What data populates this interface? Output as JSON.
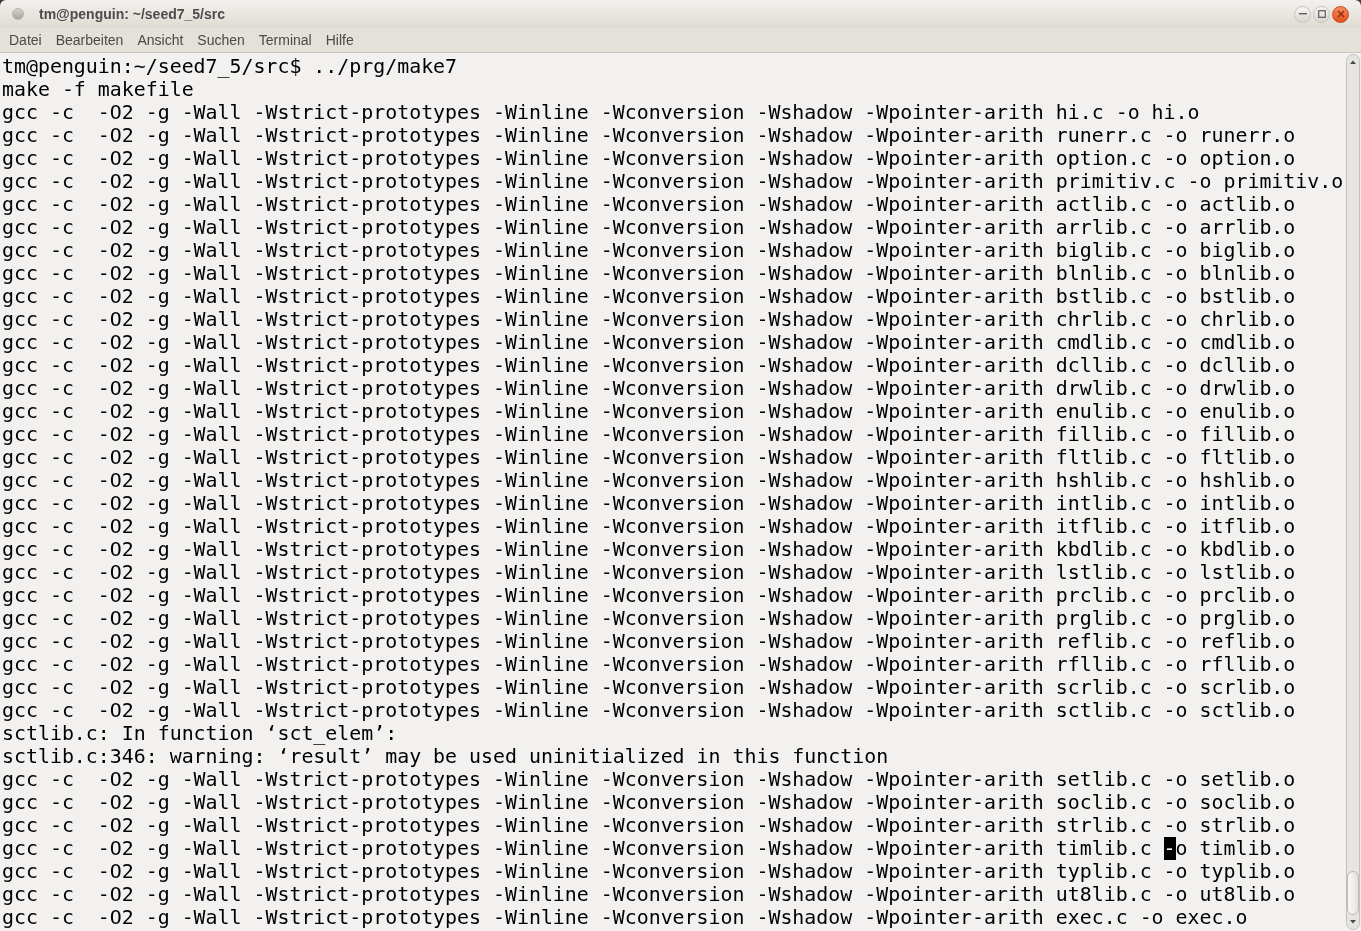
{
  "window": {
    "title": "tm@penguin: ~/seed7_5/src"
  },
  "menu": [
    "Datei",
    "Bearbeiten",
    "Ansicht",
    "Suchen",
    "Terminal",
    "Hilfe"
  ],
  "terminal": {
    "lines": [
      {
        "kind": "plain",
        "text": "tm@penguin:~/seed7_5/src$ ../prg/make7"
      },
      {
        "kind": "plain",
        "text": "make -f makefile"
      },
      {
        "kind": "plain",
        "text": "gcc -c  -O2 -g -Wall -Wstrict-prototypes -Winline -Wconversion -Wshadow -Wpointer-arith hi.c -o hi.o"
      },
      {
        "kind": "plain",
        "text": "gcc -c  -O2 -g -Wall -Wstrict-prototypes -Winline -Wconversion -Wshadow -Wpointer-arith runerr.c -o runerr.o"
      },
      {
        "kind": "plain",
        "text": "gcc -c  -O2 -g -Wall -Wstrict-prototypes -Winline -Wconversion -Wshadow -Wpointer-arith option.c -o option.o"
      },
      {
        "kind": "plain",
        "text": "gcc -c  -O2 -g -Wall -Wstrict-prototypes -Winline -Wconversion -Wshadow -Wpointer-arith primitiv.c -o primitiv.o"
      },
      {
        "kind": "plain",
        "text": "gcc -c  -O2 -g -Wall -Wstrict-prototypes -Winline -Wconversion -Wshadow -Wpointer-arith actlib.c -o actlib.o"
      },
      {
        "kind": "plain",
        "text": "gcc -c  -O2 -g -Wall -Wstrict-prototypes -Winline -Wconversion -Wshadow -Wpointer-arith arrlib.c -o arrlib.o"
      },
      {
        "kind": "plain",
        "text": "gcc -c  -O2 -g -Wall -Wstrict-prototypes -Winline -Wconversion -Wshadow -Wpointer-arith biglib.c -o biglib.o"
      },
      {
        "kind": "plain",
        "text": "gcc -c  -O2 -g -Wall -Wstrict-prototypes -Winline -Wconversion -Wshadow -Wpointer-arith blnlib.c -o blnlib.o"
      },
      {
        "kind": "plain",
        "text": "gcc -c  -O2 -g -Wall -Wstrict-prototypes -Winline -Wconversion -Wshadow -Wpointer-arith bstlib.c -o bstlib.o"
      },
      {
        "kind": "plain",
        "text": "gcc -c  -O2 -g -Wall -Wstrict-prototypes -Winline -Wconversion -Wshadow -Wpointer-arith chrlib.c -o chrlib.o"
      },
      {
        "kind": "plain",
        "text": "gcc -c  -O2 -g -Wall -Wstrict-prototypes -Winline -Wconversion -Wshadow -Wpointer-arith cmdlib.c -o cmdlib.o"
      },
      {
        "kind": "plain",
        "text": "gcc -c  -O2 -g -Wall -Wstrict-prototypes -Winline -Wconversion -Wshadow -Wpointer-arith dcllib.c -o dcllib.o"
      },
      {
        "kind": "plain",
        "text": "gcc -c  -O2 -g -Wall -Wstrict-prototypes -Winline -Wconversion -Wshadow -Wpointer-arith drwlib.c -o drwlib.o"
      },
      {
        "kind": "plain",
        "text": "gcc -c  -O2 -g -Wall -Wstrict-prototypes -Winline -Wconversion -Wshadow -Wpointer-arith enulib.c -o enulib.o"
      },
      {
        "kind": "plain",
        "text": "gcc -c  -O2 -g -Wall -Wstrict-prototypes -Winline -Wconversion -Wshadow -Wpointer-arith fillib.c -o fillib.o"
      },
      {
        "kind": "plain",
        "text": "gcc -c  -O2 -g -Wall -Wstrict-prototypes -Winline -Wconversion -Wshadow -Wpointer-arith fltlib.c -o fltlib.o"
      },
      {
        "kind": "plain",
        "text": "gcc -c  -O2 -g -Wall -Wstrict-prototypes -Winline -Wconversion -Wshadow -Wpointer-arith hshlib.c -o hshlib.o"
      },
      {
        "kind": "plain",
        "text": "gcc -c  -O2 -g -Wall -Wstrict-prototypes -Winline -Wconversion -Wshadow -Wpointer-arith intlib.c -o intlib.o"
      },
      {
        "kind": "plain",
        "text": "gcc -c  -O2 -g -Wall -Wstrict-prototypes -Winline -Wconversion -Wshadow -Wpointer-arith itflib.c -o itflib.o"
      },
      {
        "kind": "plain",
        "text": "gcc -c  -O2 -g -Wall -Wstrict-prototypes -Winline -Wconversion -Wshadow -Wpointer-arith kbdlib.c -o kbdlib.o"
      },
      {
        "kind": "plain",
        "text": "gcc -c  -O2 -g -Wall -Wstrict-prototypes -Winline -Wconversion -Wshadow -Wpointer-arith lstlib.c -o lstlib.o"
      },
      {
        "kind": "plain",
        "text": "gcc -c  -O2 -g -Wall -Wstrict-prototypes -Winline -Wconversion -Wshadow -Wpointer-arith prclib.c -o prclib.o"
      },
      {
        "kind": "plain",
        "text": "gcc -c  -O2 -g -Wall -Wstrict-prototypes -Winline -Wconversion -Wshadow -Wpointer-arith prglib.c -o prglib.o"
      },
      {
        "kind": "plain",
        "text": "gcc -c  -O2 -g -Wall -Wstrict-prototypes -Winline -Wconversion -Wshadow -Wpointer-arith reflib.c -o reflib.o"
      },
      {
        "kind": "plain",
        "text": "gcc -c  -O2 -g -Wall -Wstrict-prototypes -Winline -Wconversion -Wshadow -Wpointer-arith rfllib.c -o rfllib.o"
      },
      {
        "kind": "plain",
        "text": "gcc -c  -O2 -g -Wall -Wstrict-prototypes -Winline -Wconversion -Wshadow -Wpointer-arith scrlib.c -o scrlib.o"
      },
      {
        "kind": "plain",
        "text": "gcc -c  -O2 -g -Wall -Wstrict-prototypes -Winline -Wconversion -Wshadow -Wpointer-arith sctlib.c -o sctlib.o"
      },
      {
        "kind": "plain",
        "text": "sctlib.c: In function ‘sct_elem’:"
      },
      {
        "kind": "plain",
        "text": "sctlib.c:346: warning: ‘result’ may be used uninitialized in this function"
      },
      {
        "kind": "plain",
        "text": "gcc -c  -O2 -g -Wall -Wstrict-prototypes -Winline -Wconversion -Wshadow -Wpointer-arith setlib.c -o setlib.o"
      },
      {
        "kind": "plain",
        "text": "gcc -c  -O2 -g -Wall -Wstrict-prototypes -Winline -Wconversion -Wshadow -Wpointer-arith soclib.c -o soclib.o"
      },
      {
        "kind": "plain",
        "text": "gcc -c  -O2 -g -Wall -Wstrict-prototypes -Winline -Wconversion -Wshadow -Wpointer-arith strlib.c -o strlib.o"
      },
      {
        "kind": "cursor",
        "before": "gcc -c  -O2 -g -Wall -Wstrict-prototypes -Winline -Wconversion -Wshadow -Wpointer-arith timlib.c ",
        "cursor": "-",
        "after": "o timlib.o"
      },
      {
        "kind": "plain",
        "text": "gcc -c  -O2 -g -Wall -Wstrict-prototypes -Winline -Wconversion -Wshadow -Wpointer-arith typlib.c -o typlib.o"
      },
      {
        "kind": "plain",
        "text": "gcc -c  -O2 -g -Wall -Wstrict-prototypes -Winline -Wconversion -Wshadow -Wpointer-arith ut8lib.c -o ut8lib.o"
      },
      {
        "kind": "plain",
        "text": "gcc -c  -O2 -g -Wall -Wstrict-prototypes -Winline -Wconversion -Wshadow -Wpointer-arith exec.c -o exec.o"
      }
    ]
  }
}
